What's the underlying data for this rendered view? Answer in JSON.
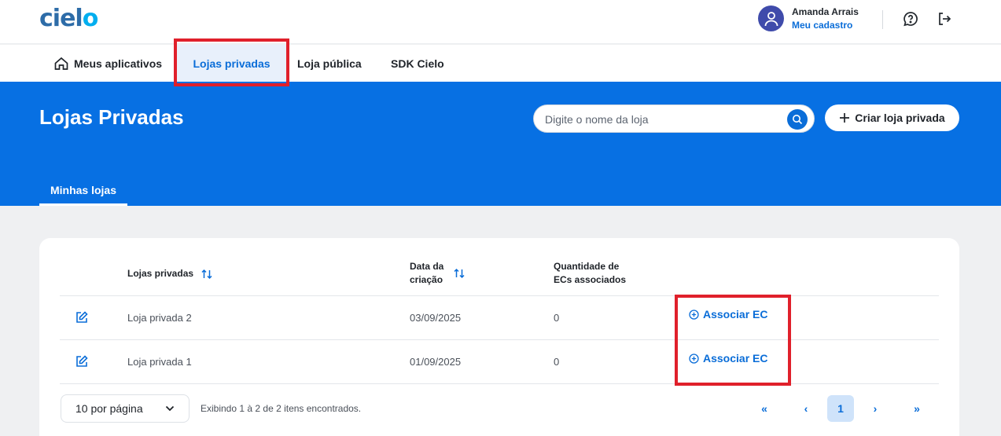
{
  "brand": {
    "logo_text": "ciel",
    "logo_o": "o"
  },
  "user": {
    "name": "Amanda Arrais",
    "link": "Meu cadastro"
  },
  "nav": {
    "items": [
      {
        "label": "Meus aplicativos"
      },
      {
        "label": "Lojas privadas"
      },
      {
        "label": "Loja pública"
      },
      {
        "label": "SDK Cielo"
      }
    ]
  },
  "banner": {
    "title": "Lojas Privadas",
    "search_placeholder": "Digite o nome da loja",
    "create_label": "Criar loja privada",
    "tab_label": "Minhas lojas"
  },
  "table": {
    "headers": {
      "name": "Lojas privadas",
      "date_line1": "Data da",
      "date_line2": "criação",
      "qty_line1": "Quantidade de",
      "qty_line2": "ECs associados"
    },
    "rows": [
      {
        "name": "Loja privada 2",
        "date": "03/09/2025",
        "qty": "0",
        "action": "Associar EC"
      },
      {
        "name": "Loja privada 1",
        "date": "01/09/2025",
        "qty": "0",
        "action": "Associar EC"
      }
    ]
  },
  "pagination": {
    "per_page": "10 por página",
    "showing": "Exibindo 1 à 2 de 2 itens encontrados.",
    "first": "«",
    "prev": "‹",
    "current": "1",
    "next": "›",
    "last": "»"
  },
  "colors": {
    "primary": "#0770e3",
    "accent": "#0a6dd8",
    "highlight": "#e0202b"
  },
  "icons": [
    "home-icon",
    "user-icon",
    "help-chat-icon",
    "logout-icon",
    "search-icon",
    "plus-icon",
    "sort-icon",
    "edit-icon",
    "plus-circle-icon",
    "chevron-down-icon"
  ]
}
